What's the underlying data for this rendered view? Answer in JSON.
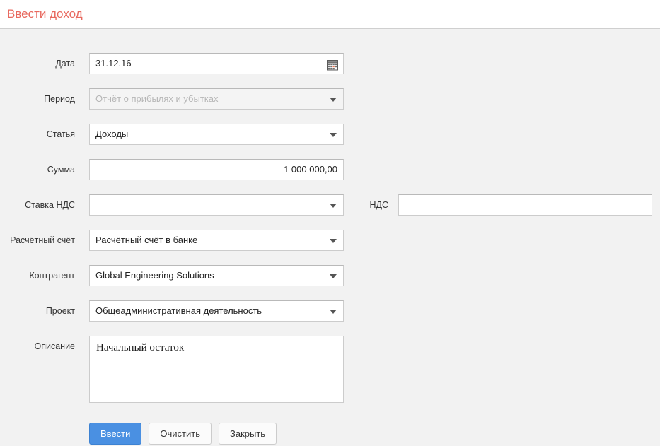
{
  "header": {
    "title": "Ввести доход",
    "title_color": "#e8685e"
  },
  "form": {
    "rows": [
      {
        "label": "Дата",
        "type": "date",
        "value": "31.12.16",
        "icon": "calendar-icon"
      },
      {
        "label": "Период",
        "type": "select",
        "value": "",
        "placeholder": "Отчёт о прибылях и убытках",
        "disabled": true
      },
      {
        "label": "Статья",
        "type": "select",
        "value": "Доходы",
        "placeholder": ""
      },
      {
        "label": "Сумма",
        "type": "number",
        "value": "1 000 000,00",
        "align": "right"
      },
      {
        "label": "Ставка НДС",
        "type": "select",
        "value": "",
        "placeholder": "",
        "second": {
          "label": "НДС",
          "value": ""
        }
      },
      {
        "label": "Расчётный счёт",
        "type": "select",
        "value": "Расчётный счёт в банке",
        "placeholder": ""
      },
      {
        "label": "Контрагент",
        "type": "select",
        "value": "Global Engineering Solutions",
        "placeholder": ""
      },
      {
        "label": "Проект",
        "type": "select",
        "value": "Общеадминистративная деятельность",
        "placeholder": ""
      }
    ],
    "description": {
      "label": "Описание",
      "value": "Начальный остаток"
    }
  },
  "buttons": {
    "submit": "Ввести",
    "clear": "Очистить",
    "close": "Закрыть",
    "primary_color": "#4a90e2"
  }
}
